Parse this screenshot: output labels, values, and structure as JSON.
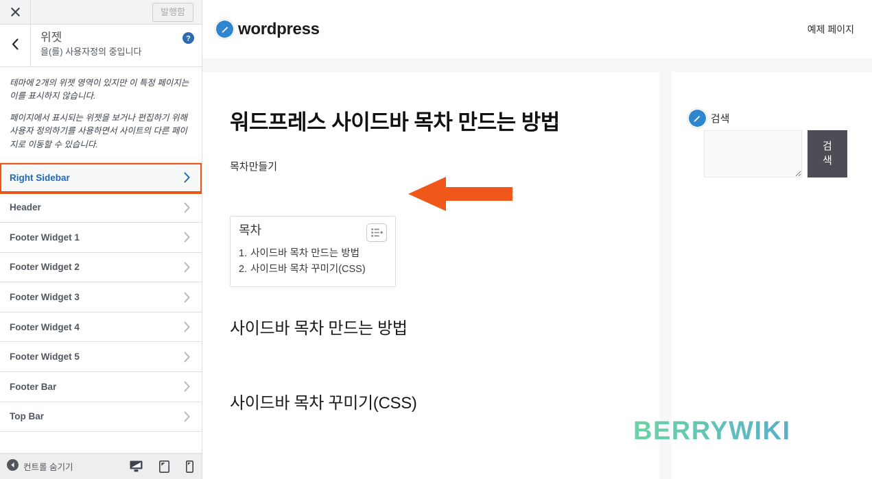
{
  "customizer": {
    "close_icon": "close-icon",
    "publish_label": "발행함",
    "back_icon": "chevron-left-icon",
    "panel_title": "위젯",
    "panel_subtitle": "을(를) 사용자정의 중입니다",
    "help_icon": "help-icon",
    "description": [
      "테마에 2개의 위젯 영역이 있지만 이 특정 페이지는 이를 표시하지 않습니다.",
      "페이지에서 표시되는 위젯을 보거나 편집하기 위해 사용자 정의하기를 사용하면서 사이트의 다른 페이지로 이동할 수 있습니다."
    ],
    "widget_areas": [
      {
        "label": "Right Sidebar",
        "selected": true
      },
      {
        "label": "Header",
        "selected": false
      },
      {
        "label": "Footer Widget 1",
        "selected": false
      },
      {
        "label": "Footer Widget 2",
        "selected": false
      },
      {
        "label": "Footer Widget 3",
        "selected": false
      },
      {
        "label": "Footer Widget 4",
        "selected": false
      },
      {
        "label": "Footer Widget 5",
        "selected": false
      },
      {
        "label": "Footer Bar",
        "selected": false
      },
      {
        "label": "Top Bar",
        "selected": false
      }
    ],
    "footer": {
      "collapse_label": "컨트롤 숨기기",
      "collapse_icon": "collapse-left-icon",
      "devices": [
        {
          "name": "desktop-preview-icon",
          "active": true
        },
        {
          "name": "tablet-preview-icon",
          "active": false
        },
        {
          "name": "mobile-preview-icon",
          "active": false
        }
      ]
    },
    "highlight_color": "#e8561a",
    "selected_text_color": "#1e6ab8"
  },
  "site": {
    "brand": {
      "name": "wordpress",
      "logo_icon": "pencil-circle-icon"
    },
    "nav": [
      {
        "label": "예제 페이지"
      }
    ],
    "post": {
      "title": "워드프레스 사이드바 목차 만드는 방법",
      "lead": "목차만들기",
      "toc": {
        "title": "목차",
        "toggle_icon": "list-toggle-icon",
        "items": [
          {
            "num": "1.",
            "label": "사이드바 목차 만드는 방법"
          },
          {
            "num": "2.",
            "label": "사이드바 목차 꾸미기(CSS)"
          }
        ]
      },
      "sections": [
        {
          "heading": "사이드바 목차 만드는 방법"
        },
        {
          "heading": "사이드바 목차 꾸미기(CSS)"
        }
      ]
    },
    "sidebar_widget": {
      "edit_icon": "pencil-circle-icon",
      "label": "검색",
      "input_value": "",
      "input_placeholder": "",
      "submit_label": "검색"
    },
    "watermark": "BERRYWIKI"
  },
  "annotation": {
    "arrow_icon": "left-arrow-annotation",
    "color": "#f0571a"
  }
}
